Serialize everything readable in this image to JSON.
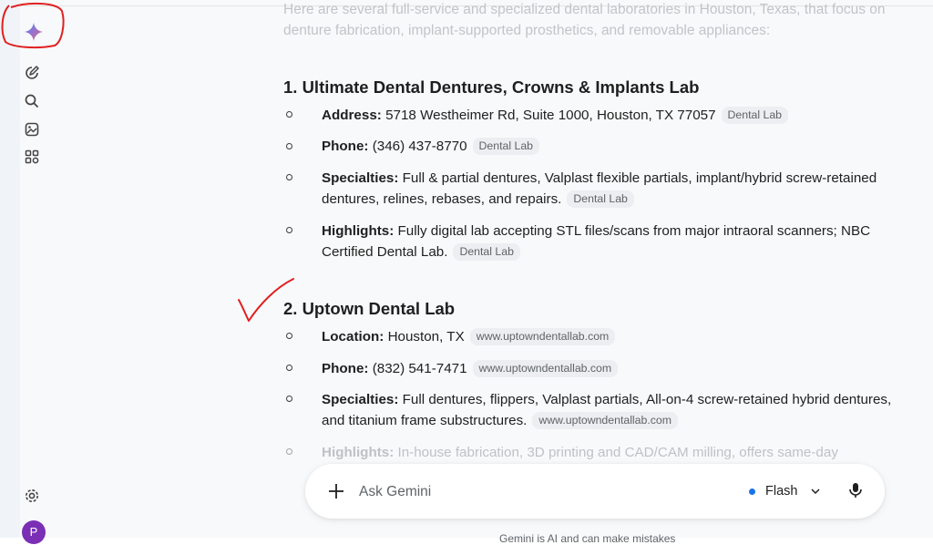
{
  "intro": {
    "line1": "Here are several full-service and specialized dental laboratories in Houston, Texas, that focus on",
    "line2": "denture fabrication, implant-supported prosthetics, and removable appliances:"
  },
  "labs": [
    {
      "heading": "1. Ultimate Dental Dentures, Crowns & Implants Lab",
      "items": [
        {
          "label": "Address:",
          "text": " 5718 Westheimer Rd, Suite 1000, Houston, TX 77057",
          "chip": "Dental Lab"
        },
        {
          "label": "Phone:",
          "text": " (346) 437-8770",
          "chip": "Dental Lab"
        },
        {
          "label": "Specialties:",
          "text": " Full & partial dentures, Valplast flexible partials, implant/hybrid screw-retained dentures, relines, rebases, and repairs.",
          "chip": "Dental Lab"
        },
        {
          "label": "Highlights:",
          "text": " Fully digital lab accepting STL files/scans from major intraoral scanners; NBC Certified Dental Lab.",
          "chip": "Dental Lab"
        }
      ]
    },
    {
      "heading": "2. Uptown Dental Lab",
      "items": [
        {
          "label": "Location:",
          "text": " Houston, TX",
          "chip": "www.uptowndentallab.com"
        },
        {
          "label": "Phone:",
          "text": " (832) 541-7471",
          "chip": "www.uptowndentallab.com"
        },
        {
          "label": "Specialties:",
          "text": " Full dentures, flippers, Valplast partials, All-on-4 screw-retained hybrid dentures, and titanium frame substructures.",
          "chip": "www.uptowndentallab.com"
        },
        {
          "label": "Highlights:",
          "text": " In-house fabrication, 3D printing and CAD/CAM milling, offers same-day"
        }
      ]
    }
  ],
  "composer": {
    "placeholder": "Ask Gemini",
    "model_label": "Flash"
  },
  "footer": {
    "disclaimer": "Gemini is AI and can make mistakes"
  },
  "user": {
    "avatar_letter": "P"
  },
  "colors": {
    "annotation_red": "#e02020",
    "accent_blue": "#1a73e8",
    "avatar_purple": "#7b2fb5"
  },
  "icons": [
    "gemini-logo-icon",
    "new-chat-icon",
    "search-icon",
    "gallery-icon",
    "gems-icon",
    "settings-icon",
    "plus-icon",
    "chevron-down-icon",
    "mic-icon"
  ]
}
